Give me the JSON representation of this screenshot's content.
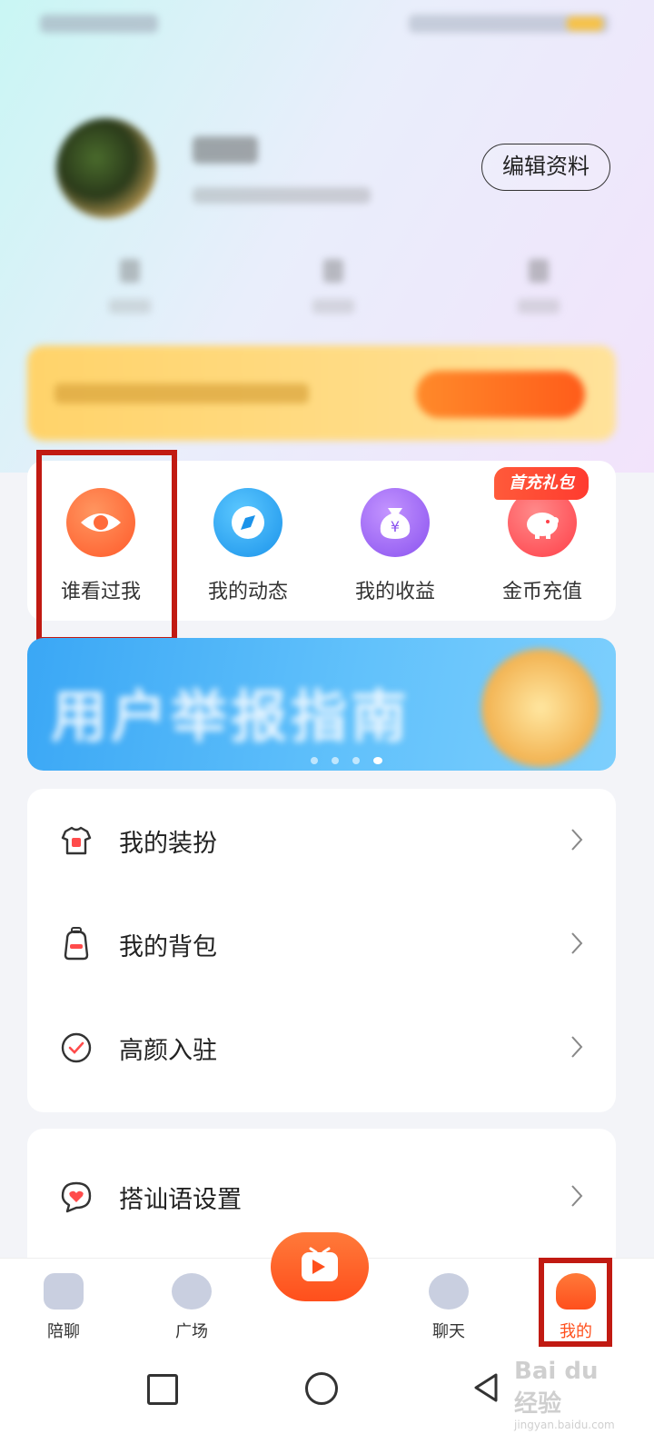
{
  "profile": {
    "edit_button": "编辑资料"
  },
  "quick_actions": [
    {
      "label": "谁看过我",
      "icon": "eye-icon",
      "color": "#ff6a3a"
    },
    {
      "label": "我的动态",
      "icon": "compass-icon",
      "color": "#2aa6f2"
    },
    {
      "label": "我的收益",
      "icon": "money-bag-icon",
      "color": "#a56af3"
    },
    {
      "label": "金币充值",
      "icon": "piggy-bank-icon",
      "color": "#ff4b4b"
    }
  ],
  "first_recharge_badge": "首充礼包",
  "banner": {
    "title": "用户举报指南",
    "active_slide_index": 4,
    "slides": 4
  },
  "menu_group_1": [
    {
      "label": "我的装扮",
      "icon": "tshirt-icon"
    },
    {
      "label": "我的背包",
      "icon": "backpack-icon"
    },
    {
      "label": "高颜入驻",
      "icon": "check-circle-icon"
    }
  ],
  "menu_group_2": [
    {
      "label": "搭讪语设置",
      "icon": "heart-chat-icon"
    }
  ],
  "tabbar": {
    "tabs": [
      {
        "label": "陪聊",
        "icon": "home-icon"
      },
      {
        "label": "广场",
        "icon": "planet-icon"
      },
      {
        "label": "聊天",
        "icon": "chat-icon"
      },
      {
        "label": "我的",
        "icon": "user-icon"
      }
    ],
    "active": "我的",
    "accent": "#ff4f1c"
  },
  "watermark": {
    "brand": "Bai du 经验",
    "url": "jingyan.baidu.com"
  },
  "highlight_color": "#c11a12"
}
